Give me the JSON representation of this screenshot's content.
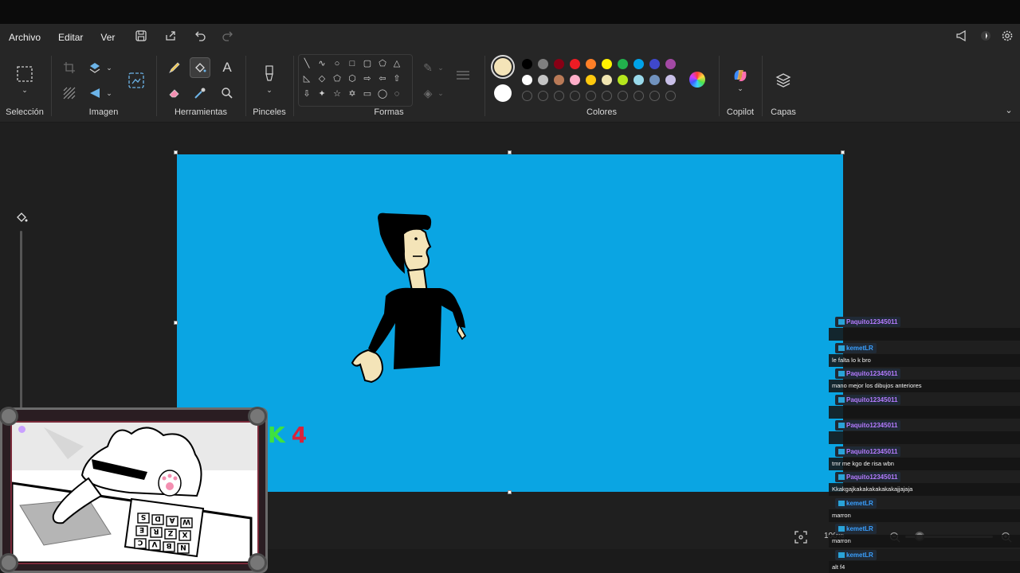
{
  "menu": {
    "file": "Archivo",
    "edit": "Editar",
    "view": "Ver"
  },
  "icons": [
    "save-icon",
    "share-icon",
    "undo-icon",
    "redo-icon",
    "announcement-icon",
    "account-icon",
    "settings-icon"
  ],
  "ribbon": {
    "selection_label": "Selección",
    "image_label": "Imagen",
    "tools_label": "Herramientas",
    "brushes_label": "Pinceles",
    "shapes_label": "Formas",
    "colors_label": "Colores",
    "copilot_label": "Copilot",
    "layers_label": "Capas"
  },
  "colors": {
    "primary": "#f4e4b8",
    "secondary": "#ffffff",
    "row1": [
      "#000000",
      "#7f7f7f",
      "#880015",
      "#ed1c24",
      "#ff7f27",
      "#fff200",
      "#22b14c",
      "#00a2e8",
      "#3f48cc",
      "#a349a4"
    ],
    "row2": [
      "#ffffff",
      "#c3c3c3",
      "#b97a57",
      "#ffaec9",
      "#ffc90e",
      "#efe4b0",
      "#b5e61d",
      "#99d9ea",
      "#7092be",
      "#c8bfe7"
    ]
  },
  "canvas": {
    "background": "#0aa5e3"
  },
  "overlay": {
    "k_text": "K",
    "num_text": "4",
    "keyboard_keys": [
      "S",
      "D",
      "A",
      "W",
      "E",
      "R",
      "Z",
      "X",
      "C",
      "V",
      "B",
      "N"
    ]
  },
  "zoom": {
    "value": "100%"
  },
  "chat": [
    {
      "user": "Paquito12345011",
      "color": "#b47bff",
      "text": ""
    },
    {
      "user": "kemetLR",
      "color": "#3aa0ff",
      "text": "le falta lo k bro"
    },
    {
      "user": "Paquito12345011",
      "color": "#b47bff",
      "text": "mano mejor los dibujos anteriores"
    },
    {
      "user": "Paquito12345011",
      "color": "#b47bff",
      "text": ""
    },
    {
      "user": "Paquito12345011",
      "color": "#b47bff",
      "text": ""
    },
    {
      "user": "Paquito12345011",
      "color": "#b47bff",
      "text": "tmr me kgo de risa wbn"
    },
    {
      "user": "Paquito12345011",
      "color": "#b47bff",
      "text": "Kkakgajkakakakakakakajjajaja"
    },
    {
      "user": "kemetLR",
      "color": "#3aa0ff",
      "text": "marron"
    },
    {
      "user": "kemetLR",
      "color": "#3aa0ff",
      "text": "marron"
    },
    {
      "user": "kemetLR",
      "color": "#3aa0ff",
      "text": "alt f4"
    }
  ]
}
